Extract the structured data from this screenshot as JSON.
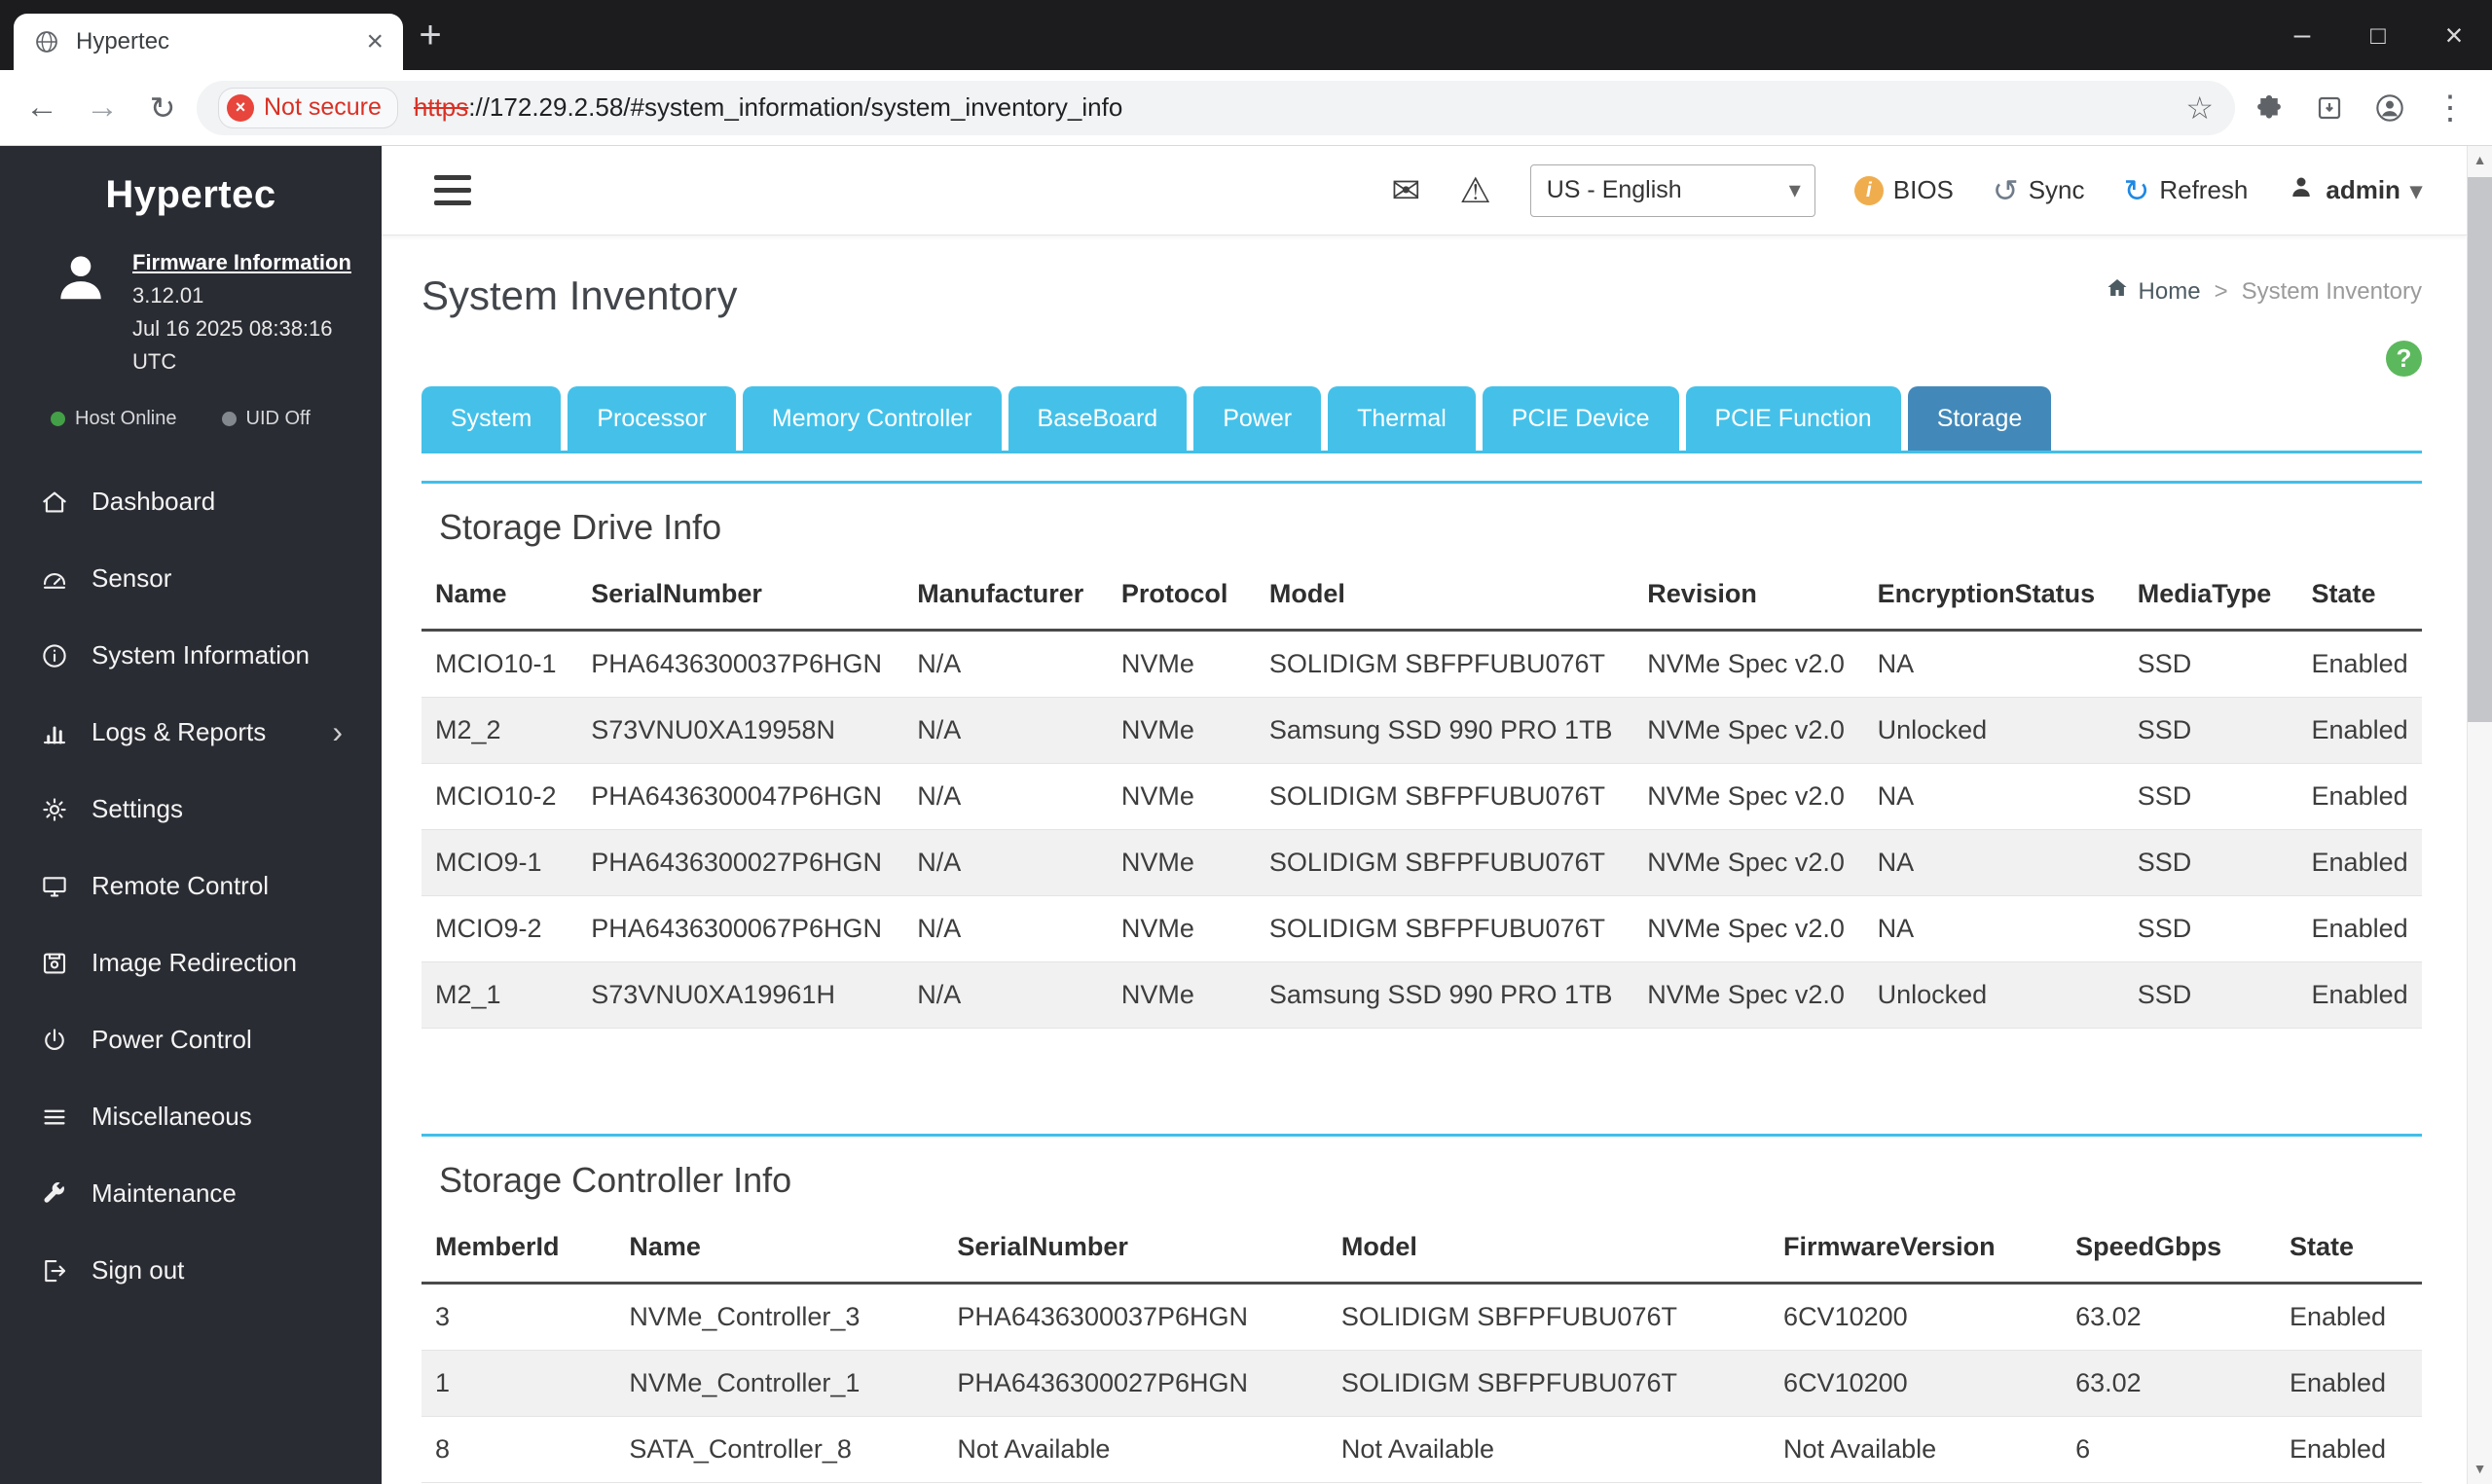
{
  "browser": {
    "tab_title": "Hypertec",
    "not_secure": "Not secure",
    "url_scheme": "https",
    "url_rest": "://172.29.2.58/#system_information/system_inventory_info"
  },
  "sidebar": {
    "brand": "Hypertec",
    "firmware_link": "Firmware Information",
    "firmware_version": "3.12.01",
    "firmware_timestamp": "Jul 16 2025 08:38:16 UTC",
    "host_status": "Host Online",
    "uid_status": "UID Off",
    "items": [
      {
        "label": "Dashboard"
      },
      {
        "label": "Sensor"
      },
      {
        "label": "System Information"
      },
      {
        "label": "Logs & Reports"
      },
      {
        "label": "Settings"
      },
      {
        "label": "Remote Control"
      },
      {
        "label": "Image Redirection"
      },
      {
        "label": "Power Control"
      },
      {
        "label": "Miscellaneous"
      },
      {
        "label": "Maintenance"
      },
      {
        "label": "Sign out"
      }
    ]
  },
  "header": {
    "language": "US - English",
    "bios_label": "BIOS",
    "sync_label": "Sync",
    "refresh_label": "Refresh",
    "user_label": "admin"
  },
  "page": {
    "title": "System Inventory",
    "breadcrumb": {
      "home": "Home",
      "separator": ">",
      "current": "System Inventory"
    }
  },
  "tabs": [
    {
      "label": "System",
      "active": false
    },
    {
      "label": "Processor",
      "active": false
    },
    {
      "label": "Memory Controller",
      "active": false
    },
    {
      "label": "BaseBoard",
      "active": false
    },
    {
      "label": "Power",
      "active": false
    },
    {
      "label": "Thermal",
      "active": false
    },
    {
      "label": "PCIE Device",
      "active": false
    },
    {
      "label": "PCIE Function",
      "active": false
    },
    {
      "label": "Storage",
      "active": true
    }
  ],
  "tables": {
    "drive": {
      "title": "Storage Drive Info",
      "headers": [
        "Name",
        "SerialNumber",
        "Manufacturer",
        "Protocol",
        "Model",
        "Revision",
        "EncryptionStatus",
        "MediaType",
        "State"
      ],
      "rows": [
        [
          "MCIO10-1",
          "PHA6436300037P6HGN",
          "N/A",
          "NVMe",
          "SOLIDIGM SBFPFUBU076T",
          "NVMe Spec v2.0",
          "NA",
          "SSD",
          "Enabled"
        ],
        [
          "M2_2",
          "S73VNU0XA19958N",
          "N/A",
          "NVMe",
          "Samsung SSD 990 PRO 1TB",
          "NVMe Spec v2.0",
          "Unlocked",
          "SSD",
          "Enabled"
        ],
        [
          "MCIO10-2",
          "PHA6436300047P6HGN",
          "N/A",
          "NVMe",
          "SOLIDIGM SBFPFUBU076T",
          "NVMe Spec v2.0",
          "NA",
          "SSD",
          "Enabled"
        ],
        [
          "MCIO9-1",
          "PHA6436300027P6HGN",
          "N/A",
          "NVMe",
          "SOLIDIGM SBFPFUBU076T",
          "NVMe Spec v2.0",
          "NA",
          "SSD",
          "Enabled"
        ],
        [
          "MCIO9-2",
          "PHA6436300067P6HGN",
          "N/A",
          "NVMe",
          "SOLIDIGM SBFPFUBU076T",
          "NVMe Spec v2.0",
          "NA",
          "SSD",
          "Enabled"
        ],
        [
          "M2_1",
          "S73VNU0XA19961H",
          "N/A",
          "NVMe",
          "Samsung SSD 990 PRO 1TB",
          "NVMe Spec v2.0",
          "Unlocked",
          "SSD",
          "Enabled"
        ]
      ]
    },
    "controller": {
      "title": "Storage Controller Info",
      "headers": [
        "MemberId",
        "Name",
        "SerialNumber",
        "Model",
        "FirmwareVersion",
        "SpeedGbps",
        "State"
      ],
      "rows": [
        [
          "3",
          "NVMe_Controller_3",
          "PHA6436300037P6HGN",
          "SOLIDIGM SBFPFUBU076T",
          "6CV10200",
          "63.02",
          "Enabled"
        ],
        [
          "1",
          "NVMe_Controller_1",
          "PHA6436300027P6HGN",
          "SOLIDIGM SBFPFUBU076T",
          "6CV10200",
          "63.02",
          "Enabled"
        ],
        [
          "8",
          "SATA_Controller_8",
          "Not Available",
          "Not Available",
          "Not Available",
          "6",
          "Enabled"
        ]
      ]
    }
  },
  "colors": {
    "tab_inactive": "#45c1e9",
    "tab_active": "#4289ba",
    "section_border": "#41bfe8",
    "sidebar_bg": "#2a2c33",
    "not_secure_red": "#d93025",
    "bios_icon_orange": "#f0ad4e",
    "help_green": "#5cb85c",
    "host_online_green": "#43a047"
  }
}
